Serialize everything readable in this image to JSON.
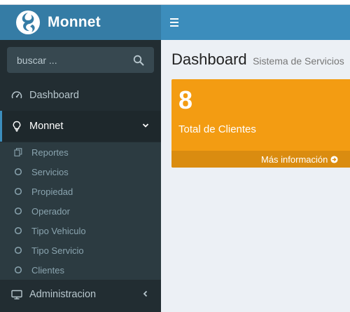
{
  "header": {
    "logo_text": "Monnet",
    "logo_icon": "monnet-swirl-logo-icon",
    "menu_toggle_icon": "hamburger-icon"
  },
  "sidebar": {
    "search": {
      "placeholder": "buscar ...",
      "value": "",
      "icon": "search-icon"
    },
    "items": [
      {
        "label": "Dashboard",
        "icon": "dashboard-gauge-icon",
        "active": false
      },
      {
        "label": "Monnet",
        "icon": "lightbulb-icon",
        "active": true,
        "caret": "chevron-down-icon"
      },
      {
        "label": "Administracion",
        "icon": "desktop-icon",
        "active": false,
        "caret": "chevron-left-icon"
      }
    ],
    "submenu": [
      {
        "label": "Reportes",
        "icon": "copy-icon"
      },
      {
        "label": "Servicios",
        "icon": "circle-outline-icon"
      },
      {
        "label": "Propiedad",
        "icon": "circle-outline-icon"
      },
      {
        "label": "Operador",
        "icon": "circle-outline-icon"
      },
      {
        "label": "Tipo Vehiculo",
        "icon": "circle-outline-icon"
      },
      {
        "label": "Tipo Servicio",
        "icon": "circle-outline-icon"
      },
      {
        "label": "Clientes",
        "icon": "circle-outline-icon"
      }
    ]
  },
  "content": {
    "title": "Dashboard",
    "subtitle": "Sistema de Servicios",
    "stat_box": {
      "count": "8",
      "label": "Total de Clientes",
      "footer_link": "Más información",
      "footer_icon": "arrow-circle-right-icon",
      "color": "#f39c12"
    }
  },
  "colors": {
    "logo_bar": "#357ca5",
    "navbar": "#3c8dbc",
    "sidebar": "#222d32",
    "submenu": "#2c3b41",
    "content_bg": "#ecf0f5"
  }
}
